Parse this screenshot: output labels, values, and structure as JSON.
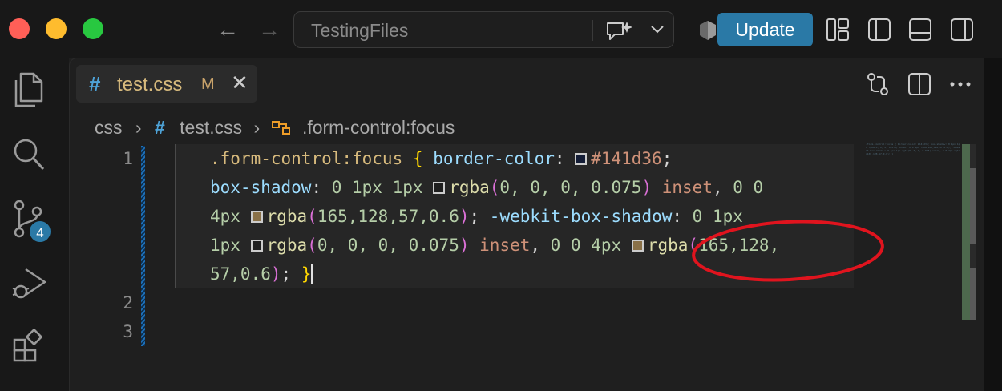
{
  "titlebar": {
    "search_text": "TestingFiles",
    "update_label": "Update"
  },
  "activity_bar": {
    "source_control_badge": "4"
  },
  "tab": {
    "hash": "#",
    "name": "test.css",
    "modified": "M",
    "close": "✕"
  },
  "breadcrumb": {
    "folder": "css",
    "hash": "#",
    "file": "test.css",
    "symbol": ".form-control:focus"
  },
  "editor": {
    "line_numbers": [
      "1",
      "2",
      "3"
    ],
    "line1": {
      "selector": ".form-control:focus",
      "open_brace": "{",
      "prop1": "border-color",
      "color1": "#141d36",
      "prop2": "box-shadow",
      "nums1": "0 1px 1px",
      "fn_rgba": "rgba",
      "args_a": "0, 0, 0, 0.075",
      "inset": "inset",
      "nums2": "0 0",
      "nums3": "4px",
      "args_b": "165,128,57,0.6",
      "prop3": "-webkit-box-shadow",
      "nums4": "0 1px",
      "nums5": "1px",
      "nums6": "0 0 4px",
      "args_c1": "165,128,",
      "args_c2": "57,0.6",
      "close_brace": "}"
    },
    "swatch_colors": {
      "dark_navy": "#141d36",
      "transparent_black": "#1f1f1f",
      "tan": "#8a7148"
    }
  },
  "minimap_text": ".form-control:focus { border-color: #141d36; box-shadow: 0 1px 1px rgba(0, 0, 0, 0.075) inset, 0 0 4px rgba(165,128,57,0.6); -webkit-box-shadow: 0 1px 1px rgba(0, 0, 0, 0.075) inset, 0 0 4px rgba(165,128,57,0.6); }",
  "colors": {
    "accent": "#2a79a6",
    "annotation": "#e0141e"
  }
}
